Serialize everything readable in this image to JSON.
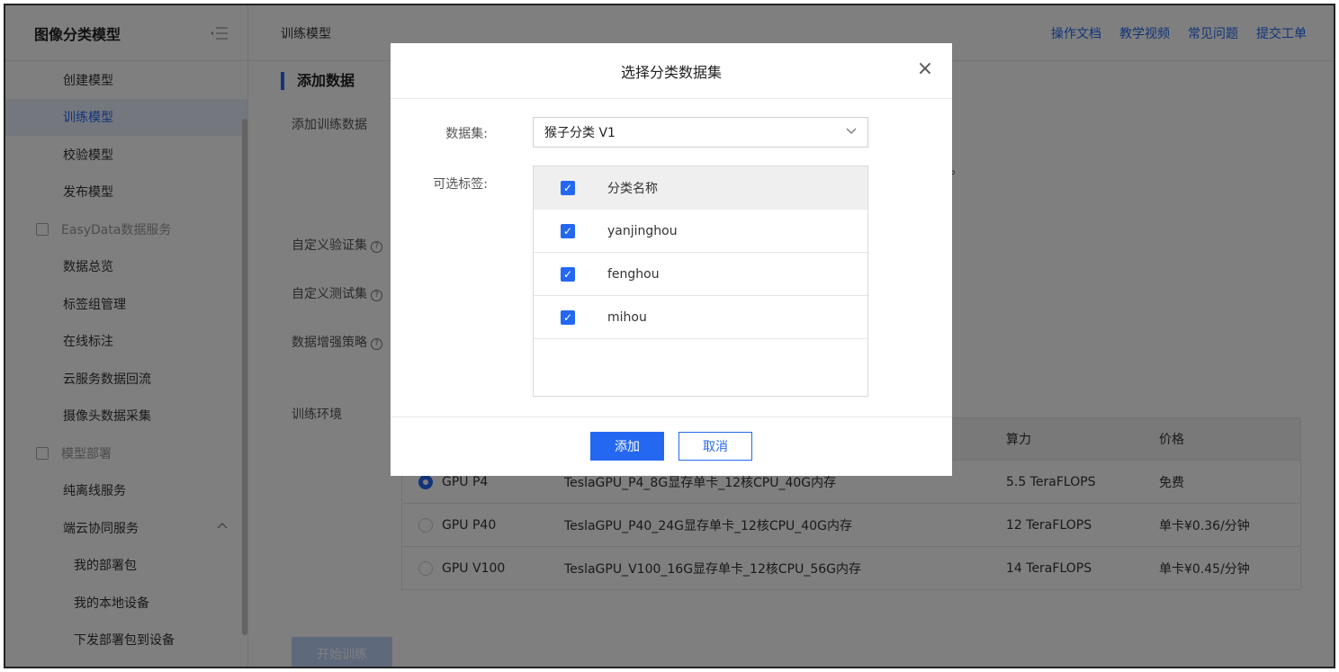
{
  "sidebar": {
    "title": "图像分类模型",
    "items": [
      {
        "label": "创建模型",
        "kind": "item"
      },
      {
        "label": "训练模型",
        "kind": "item",
        "active": true
      },
      {
        "label": "校验模型",
        "kind": "item"
      },
      {
        "label": "发布模型",
        "kind": "item"
      },
      {
        "label": "EasyData数据服务",
        "kind": "group"
      },
      {
        "label": "数据总览",
        "kind": "item"
      },
      {
        "label": "标签组管理",
        "kind": "item"
      },
      {
        "label": "在线标注",
        "kind": "item"
      },
      {
        "label": "云服务数据回流",
        "kind": "item"
      },
      {
        "label": "摄像头数据采集",
        "kind": "item"
      },
      {
        "label": "模型部署",
        "kind": "group"
      },
      {
        "label": "纯离线服务",
        "kind": "item"
      },
      {
        "label": "端云协同服务",
        "kind": "item"
      },
      {
        "label": "我的部署包",
        "kind": "sub"
      },
      {
        "label": "我的本地设备",
        "kind": "sub"
      },
      {
        "label": "下发部署包到设备",
        "kind": "sub"
      }
    ]
  },
  "header": {
    "breadcrumb": "训练模型",
    "links": [
      "操作文档",
      "教学视频",
      "常见问题",
      "提交工单"
    ]
  },
  "form": {
    "section_title": "添加数据",
    "add_train_data": "添加训练数据",
    "custom_val": "自定义验证集",
    "custom_test": "自定义测试集",
    "augment": "数据增强策略",
    "env": "训练环境",
    "period": "。",
    "start_button": "开始训练",
    "help_glyph": "?"
  },
  "env_table": {
    "headers": [
      "算力",
      "价格"
    ],
    "rows": [
      {
        "name": "GPU P4",
        "spec": "TeslaGPU_P4_8G显存单卡_12核CPU_40G内存",
        "power": "5.5 TeraFLOPS",
        "price": "免费",
        "selected": true
      },
      {
        "name": "GPU P40",
        "spec": "TeslaGPU_P40_24G显存单卡_12核CPU_40G内存",
        "power": "12 TeraFLOPS",
        "price": "单卡¥0.36/分钟",
        "selected": false
      },
      {
        "name": "GPU V100",
        "spec": "TeslaGPU_V100_16G显存单卡_12核CPU_56G内存",
        "power": "14 TeraFLOPS",
        "price": "单卡¥0.45/分钟",
        "selected": false
      }
    ]
  },
  "modal": {
    "title": "选择分类数据集",
    "close_glyph": "×",
    "dataset_label": "数据集:",
    "dataset_value": "猴子分类 V1",
    "tags_label": "可选标签:",
    "tags_header": "分类名称",
    "tags": [
      "yanjinghou",
      "fenghou",
      "mihou"
    ],
    "check_glyph": "✓",
    "add_button": "添加",
    "cancel_button": "取消"
  },
  "icons": {
    "collapse": "indent-icon",
    "chevron_up": "^",
    "chevron_down": "∨"
  }
}
